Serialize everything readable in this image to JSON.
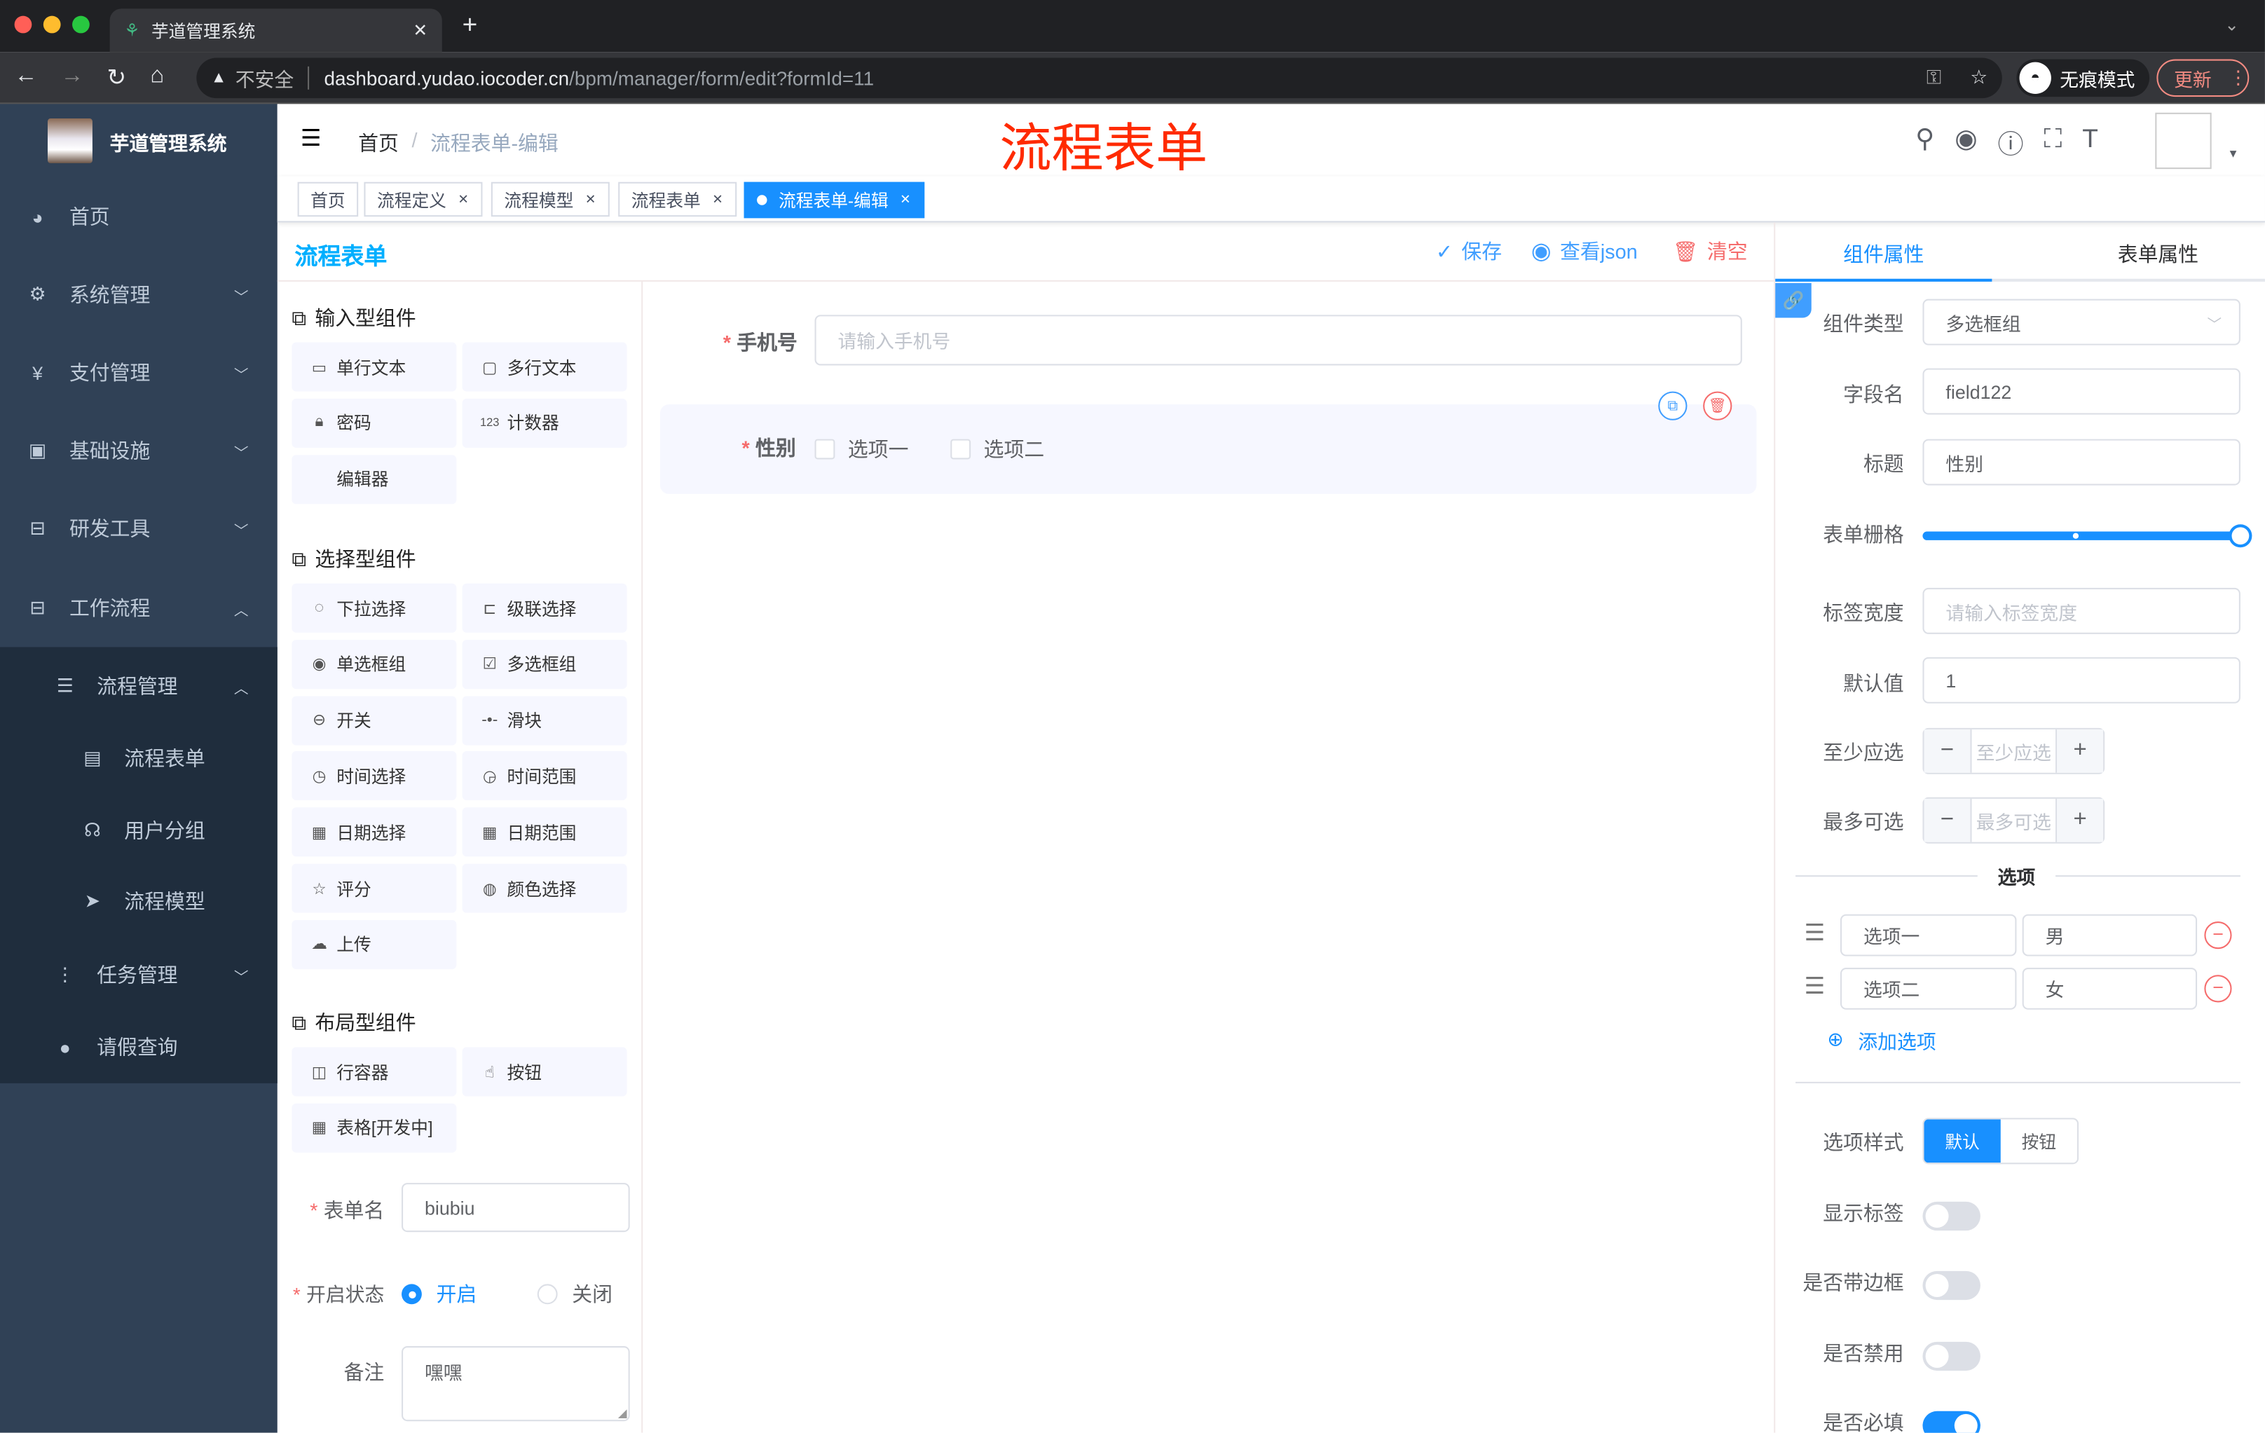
{
  "browser": {
    "tab_title": "芋道管理系统",
    "security": "不安全",
    "url_host": "dashboard.yudao.iocoder.cn",
    "url_path": "/bpm/manager/form/edit?formId=11",
    "incognito": "无痕模式",
    "update": "更新"
  },
  "sidebar": {
    "logo_title": "芋道管理系统",
    "items": [
      {
        "label": "首页",
        "icon": "dashboard-icon"
      },
      {
        "label": "系统管理",
        "icon": "gear-icon"
      },
      {
        "label": "支付管理",
        "icon": "yen-icon"
      },
      {
        "label": "基础设施",
        "icon": "monitor-icon"
      },
      {
        "label": "研发工具",
        "icon": "toolbox-icon"
      },
      {
        "label": "工作流程",
        "icon": "toolbox-icon"
      },
      {
        "label": "流程管理",
        "icon": "tree-icon"
      },
      {
        "label": "流程表单",
        "icon": "form-icon"
      },
      {
        "label": "用户分组",
        "icon": "group-icon"
      },
      {
        "label": "流程模型",
        "icon": "send-icon"
      },
      {
        "label": "任务管理",
        "icon": "tree-icon"
      },
      {
        "label": "请假查询",
        "icon": "user-icon"
      }
    ]
  },
  "navbar": {
    "breadcrumb": [
      "首页",
      "流程表单-编辑"
    ],
    "overlay_title": "流程表单"
  },
  "tags": [
    {
      "label": "首页"
    },
    {
      "label": "流程定义"
    },
    {
      "label": "流程模型"
    },
    {
      "label": "流程表单"
    },
    {
      "label": "流程表单-编辑",
      "active": true
    }
  ],
  "header": {
    "title": "流程表单",
    "save": "保存",
    "view_json": "查看json",
    "clear": "清空"
  },
  "components": {
    "input_title": "输入型组件",
    "input": [
      "单行文本",
      "多行文本",
      "密码",
      "计数器",
      "编辑器"
    ],
    "select_title": "选择型组件",
    "select": [
      "下拉选择",
      "级联选择",
      "单选框组",
      "多选框组",
      "开关",
      "滑块",
      "时间选择",
      "时间范围",
      "日期选择",
      "日期范围",
      "评分",
      "颜色选择",
      "上传"
    ],
    "layout_title": "布局型组件",
    "layout": [
      "行容器",
      "按钮",
      "表格[开发中]"
    ]
  },
  "form_meta": {
    "name_label": "表单名",
    "name_value": "biubiu",
    "status_label": "开启状态",
    "status_on": "开启",
    "status_off": "关闭",
    "status_selected": "开启",
    "remark_label": "备注",
    "remark_value": "嘿嘿"
  },
  "canvas": {
    "phone_label": "手机号",
    "phone_placeholder": "请输入手机号",
    "gender_label": "性别",
    "options": [
      "选项一",
      "选项二"
    ]
  },
  "props": {
    "tab_component": "组件属性",
    "tab_form": "表单属性",
    "type_label": "组件类型",
    "type_value": "多选框组",
    "field_label": "字段名",
    "field_value": "field122",
    "title_label": "标题",
    "title_value": "性别",
    "grid_label": "表单栅格",
    "grid_value": 24,
    "labelwidth_label": "标签宽度",
    "labelwidth_placeholder": "请输入标签宽度",
    "default_label": "默认值",
    "default_value": "1",
    "min_label": "至少应选",
    "min_placeholder": "至少应选",
    "max_label": "最多可选",
    "max_placeholder": "最多可选",
    "options_title": "选项",
    "options": [
      {
        "label": "选项一",
        "value": "男"
      },
      {
        "label": "选项二",
        "value": "女"
      }
    ],
    "add_option": "添加选项",
    "style_label": "选项样式",
    "style_default": "默认",
    "style_button": "按钮",
    "show_label": "显示标签",
    "show_label_on": true,
    "border_label": "是否带边框",
    "border_on": false,
    "disabled_label": "是否禁用",
    "disabled_on": false,
    "required_label": "是否必填",
    "required_on": true
  },
  "colors": {
    "primary": "#1890ff",
    "sidebar": "#304156",
    "submenu": "#1f2d3d",
    "danger": "#f56c6c",
    "overlay_title": "#ff2a00"
  }
}
